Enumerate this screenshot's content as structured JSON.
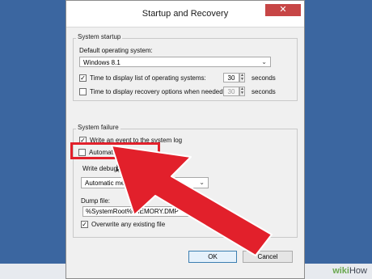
{
  "dialog": {
    "title": "Startup and Recovery",
    "close_glyph": "✕"
  },
  "system_startup": {
    "group_label": "System startup",
    "default_os_label": "Default operating system:",
    "default_os_value": "Windows 8.1",
    "time_list": {
      "checked": true,
      "label": "Time to display list of operating systems:",
      "value": "30",
      "unit": "seconds"
    },
    "time_recovery": {
      "checked": false,
      "label": "Time to display recovery options when needed:",
      "value": "30",
      "unit": "seconds"
    }
  },
  "system_failure": {
    "group_label": "System failure",
    "write_event": {
      "checked": true,
      "label": "Write an event to the system log"
    },
    "auto_restart": {
      "checked": false,
      "label": "Automatically restart"
    },
    "debug_label": "Write debugging information",
    "debug_value": "Automatic memory dump",
    "dump_file_label": "Dump file:",
    "dump_file_value": "%SystemRoot%\\MEMORY.DMP",
    "overwrite": {
      "checked": true,
      "label": "Overwrite any existing file"
    }
  },
  "buttons": {
    "ok": "OK",
    "cancel": "Cancel"
  },
  "watermark": {
    "prefix": "wiki",
    "suffix": "How"
  },
  "colors": {
    "highlight": "#e2202b",
    "arrow": "#e2202b",
    "background": "#3b66a0"
  },
  "icons": {
    "check": "✓",
    "chevron": "⌄",
    "spin_up": "▲",
    "spin_down": "▼"
  }
}
